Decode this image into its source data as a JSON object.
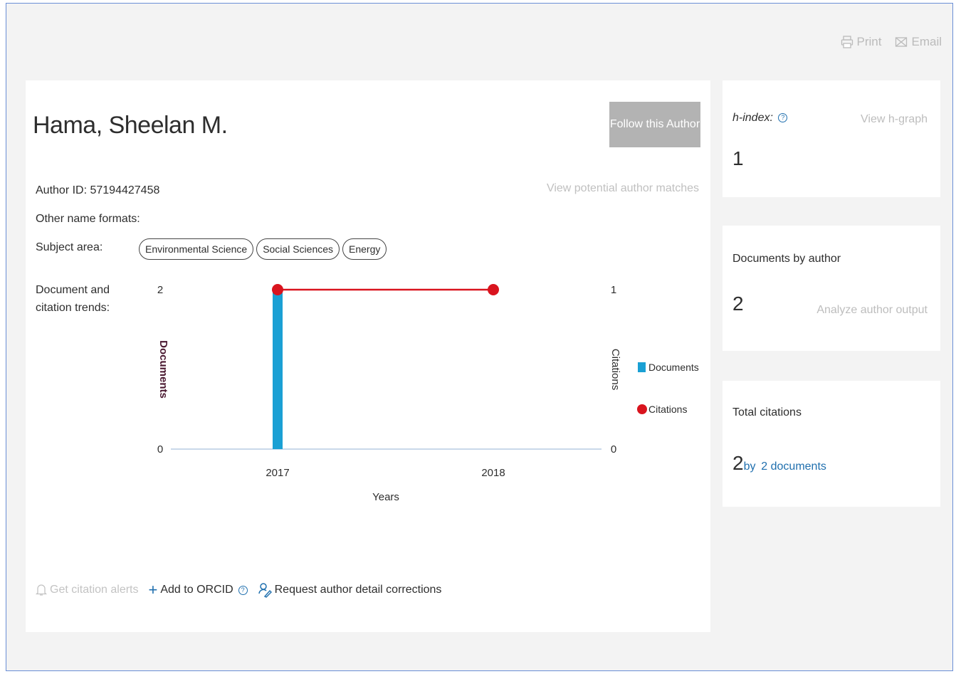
{
  "toolbar": {
    "print_label": "Print",
    "email_label": "Email"
  },
  "author": {
    "name": "Hama, Sheelan M.",
    "follow_label": "Follow this Author",
    "potential_matches_label": "View potential author matches",
    "author_id_label": "Author ID: 57194427458",
    "other_names_label": "Other name formats:",
    "subject_area_label": "Subject area:",
    "subject_areas": [
      "Environmental Science",
      "Social Sciences",
      "Energy"
    ],
    "trends_label": "Document and citation trends:"
  },
  "chart_data": {
    "type": "bar",
    "categories": [
      "2017",
      "2018"
    ],
    "series": [
      {
        "name": "Documents",
        "type": "bar",
        "axis": "left",
        "values": [
          2,
          0
        ],
        "color": "#1aa0d4"
      },
      {
        "name": "Citations",
        "type": "line",
        "axis": "right",
        "values": [
          1,
          1
        ],
        "color": "#d9141e"
      }
    ],
    "xlabel": "Years",
    "ylabel": "Documents",
    "y2label": "Citations",
    "ylim": [
      0,
      2
    ],
    "y2lim": [
      0,
      1
    ],
    "yticks": [
      "0",
      "2"
    ],
    "y2ticks": [
      "0",
      "1"
    ],
    "legend": "right"
  },
  "bottom_links": {
    "alerts_label": "Get citation alerts",
    "orcid_label": "Add to ORCID",
    "corrections_label": "Request author detail corrections"
  },
  "metrics": {
    "hindex_label": "h-index:",
    "hindex_value": "1",
    "hgraph_label": "View h-graph",
    "documents_label": "Documents by author",
    "documents_value": "2",
    "analyze_label": "Analyze author output",
    "citations_label": "Total citations",
    "citations_value": "2",
    "citations_by": "by",
    "citations_docs_count": "2",
    "citations_docs_word": "documents"
  },
  "colors": {
    "documents_bar": "#1aa0d4",
    "citations_line": "#d9141e",
    "link_blue": "#1f6fae",
    "follow_button": "#b3b3b3"
  }
}
